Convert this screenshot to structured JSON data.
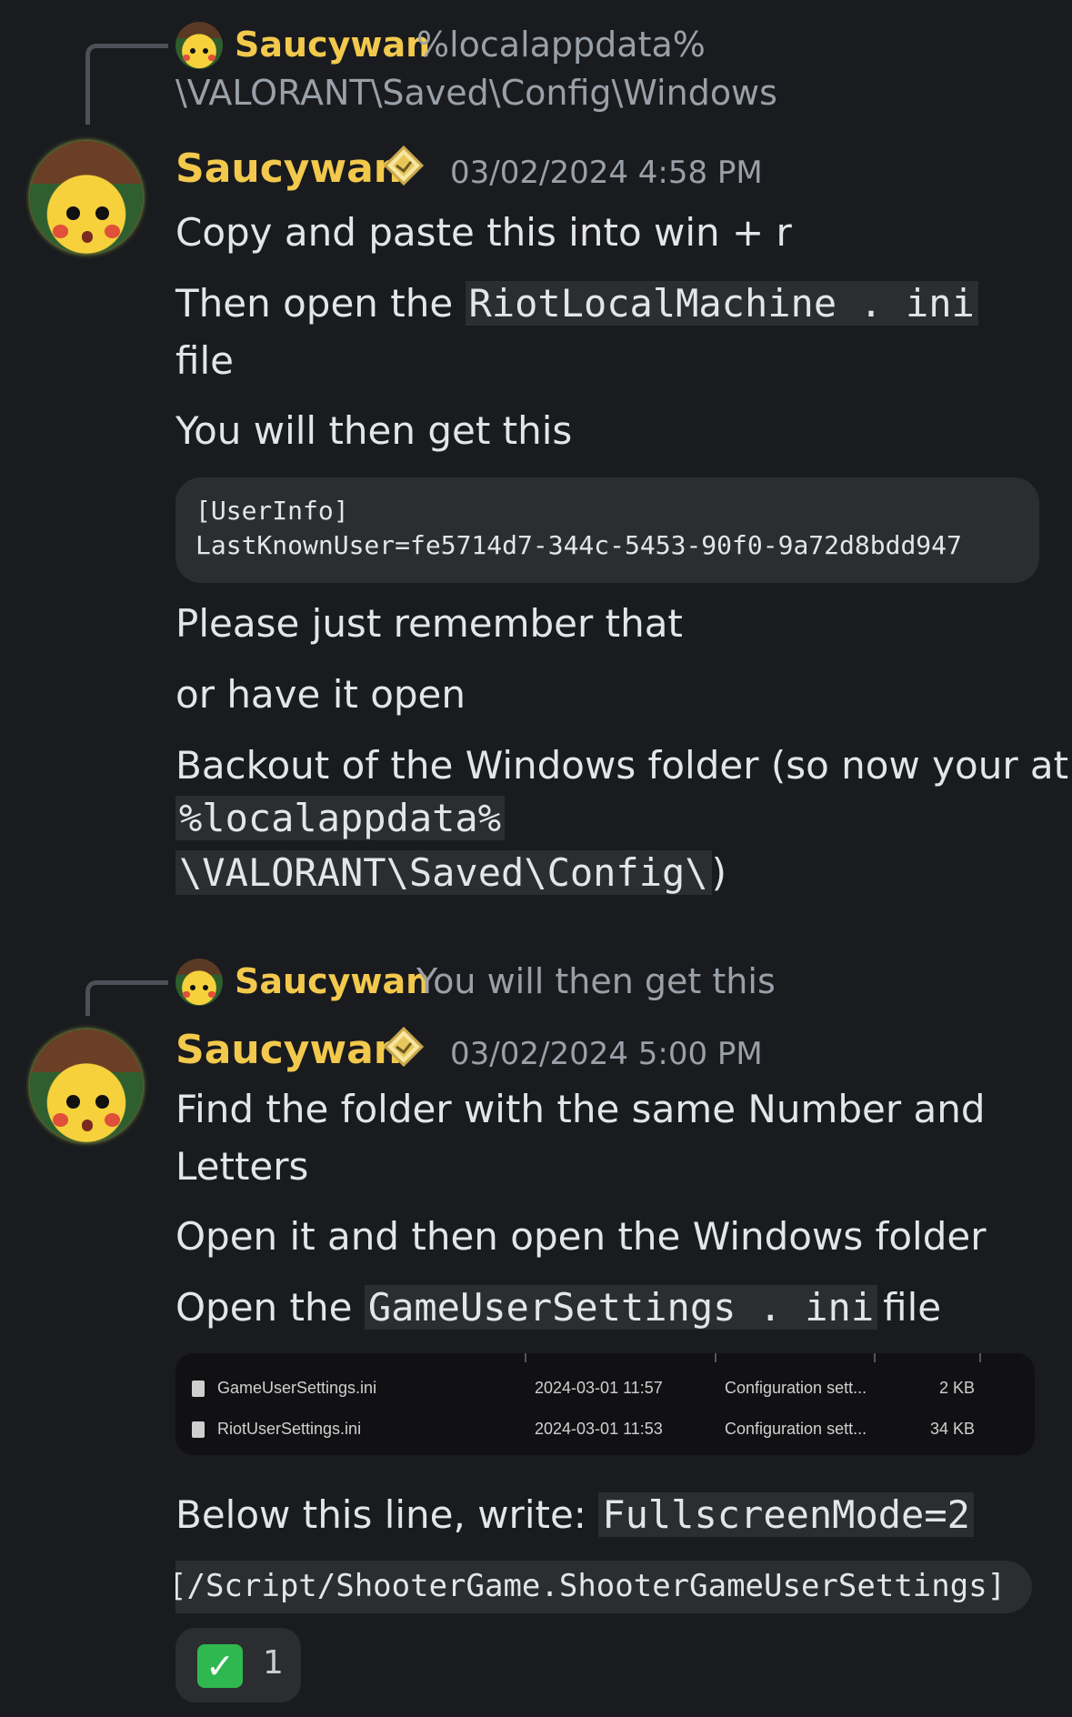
{
  "messages": [
    {
      "reply": {
        "author": "Saucywan",
        "text_line1": "%localappdata%",
        "text_line2": "\\VALORANT\\Saved\\Config\\Windows"
      },
      "author": "Saucywan",
      "timestamp": "03/02/2024 4:58 PM",
      "lines": {
        "l1": "Copy and paste this into win + r",
        "l2_pre": "Then open the ",
        "l2_code": "RiotLocalMachine . ini",
        "l2_post": "file",
        "l3": "You will then get this",
        "code_block": [
          "[UserInfo]",
          "LastKnownUser=fe5714d7-344c-5453-90f0-9a72d8bdd947"
        ],
        "l4": "Please just remember that",
        "l5": "or have it open",
        "l6": "Backout of the Windows folder (so now your at",
        "l6_code1": "%localappdata%",
        "l6_code2": "\\VALORANT\\Saved\\Config\\",
        "l6_tail": ")"
      }
    },
    {
      "reply": {
        "author": "Saucywan",
        "text_line1": "You will then get this"
      },
      "author": "Saucywan",
      "timestamp": "03/02/2024 5:00 PM",
      "lines": {
        "l1a": "Find the folder with the same Number and",
        "l1b": "Letters",
        "l2": "Open it and then open the Windows folder",
        "l3_pre": "Open the ",
        "l3_code": "GameUserSettings . ini",
        "l3_post": "file",
        "files": [
          {
            "name": "GameUserSettings.ini",
            "date": "2024-03-01 11:57",
            "type": "Configuration sett...",
            "size": "2 KB"
          },
          {
            "name": "RiotUserSettings.ini",
            "date": "2024-03-01 11:53",
            "type": "Configuration sett...",
            "size": "34 KB"
          }
        ],
        "l4_pre": "Below this line, write: ",
        "l4_code": "FullscreenMode=2",
        "code_strip": "[/Script/ShooterGame.ShooterGameUserSettings]"
      },
      "reaction": {
        "emoji": "check-mark",
        "count": "1"
      }
    }
  ],
  "colors": {
    "background": "#1a1b1f",
    "username": "#f2c94c",
    "code_bg": "#2b2d31",
    "reaction_check": "#2fb84f"
  }
}
